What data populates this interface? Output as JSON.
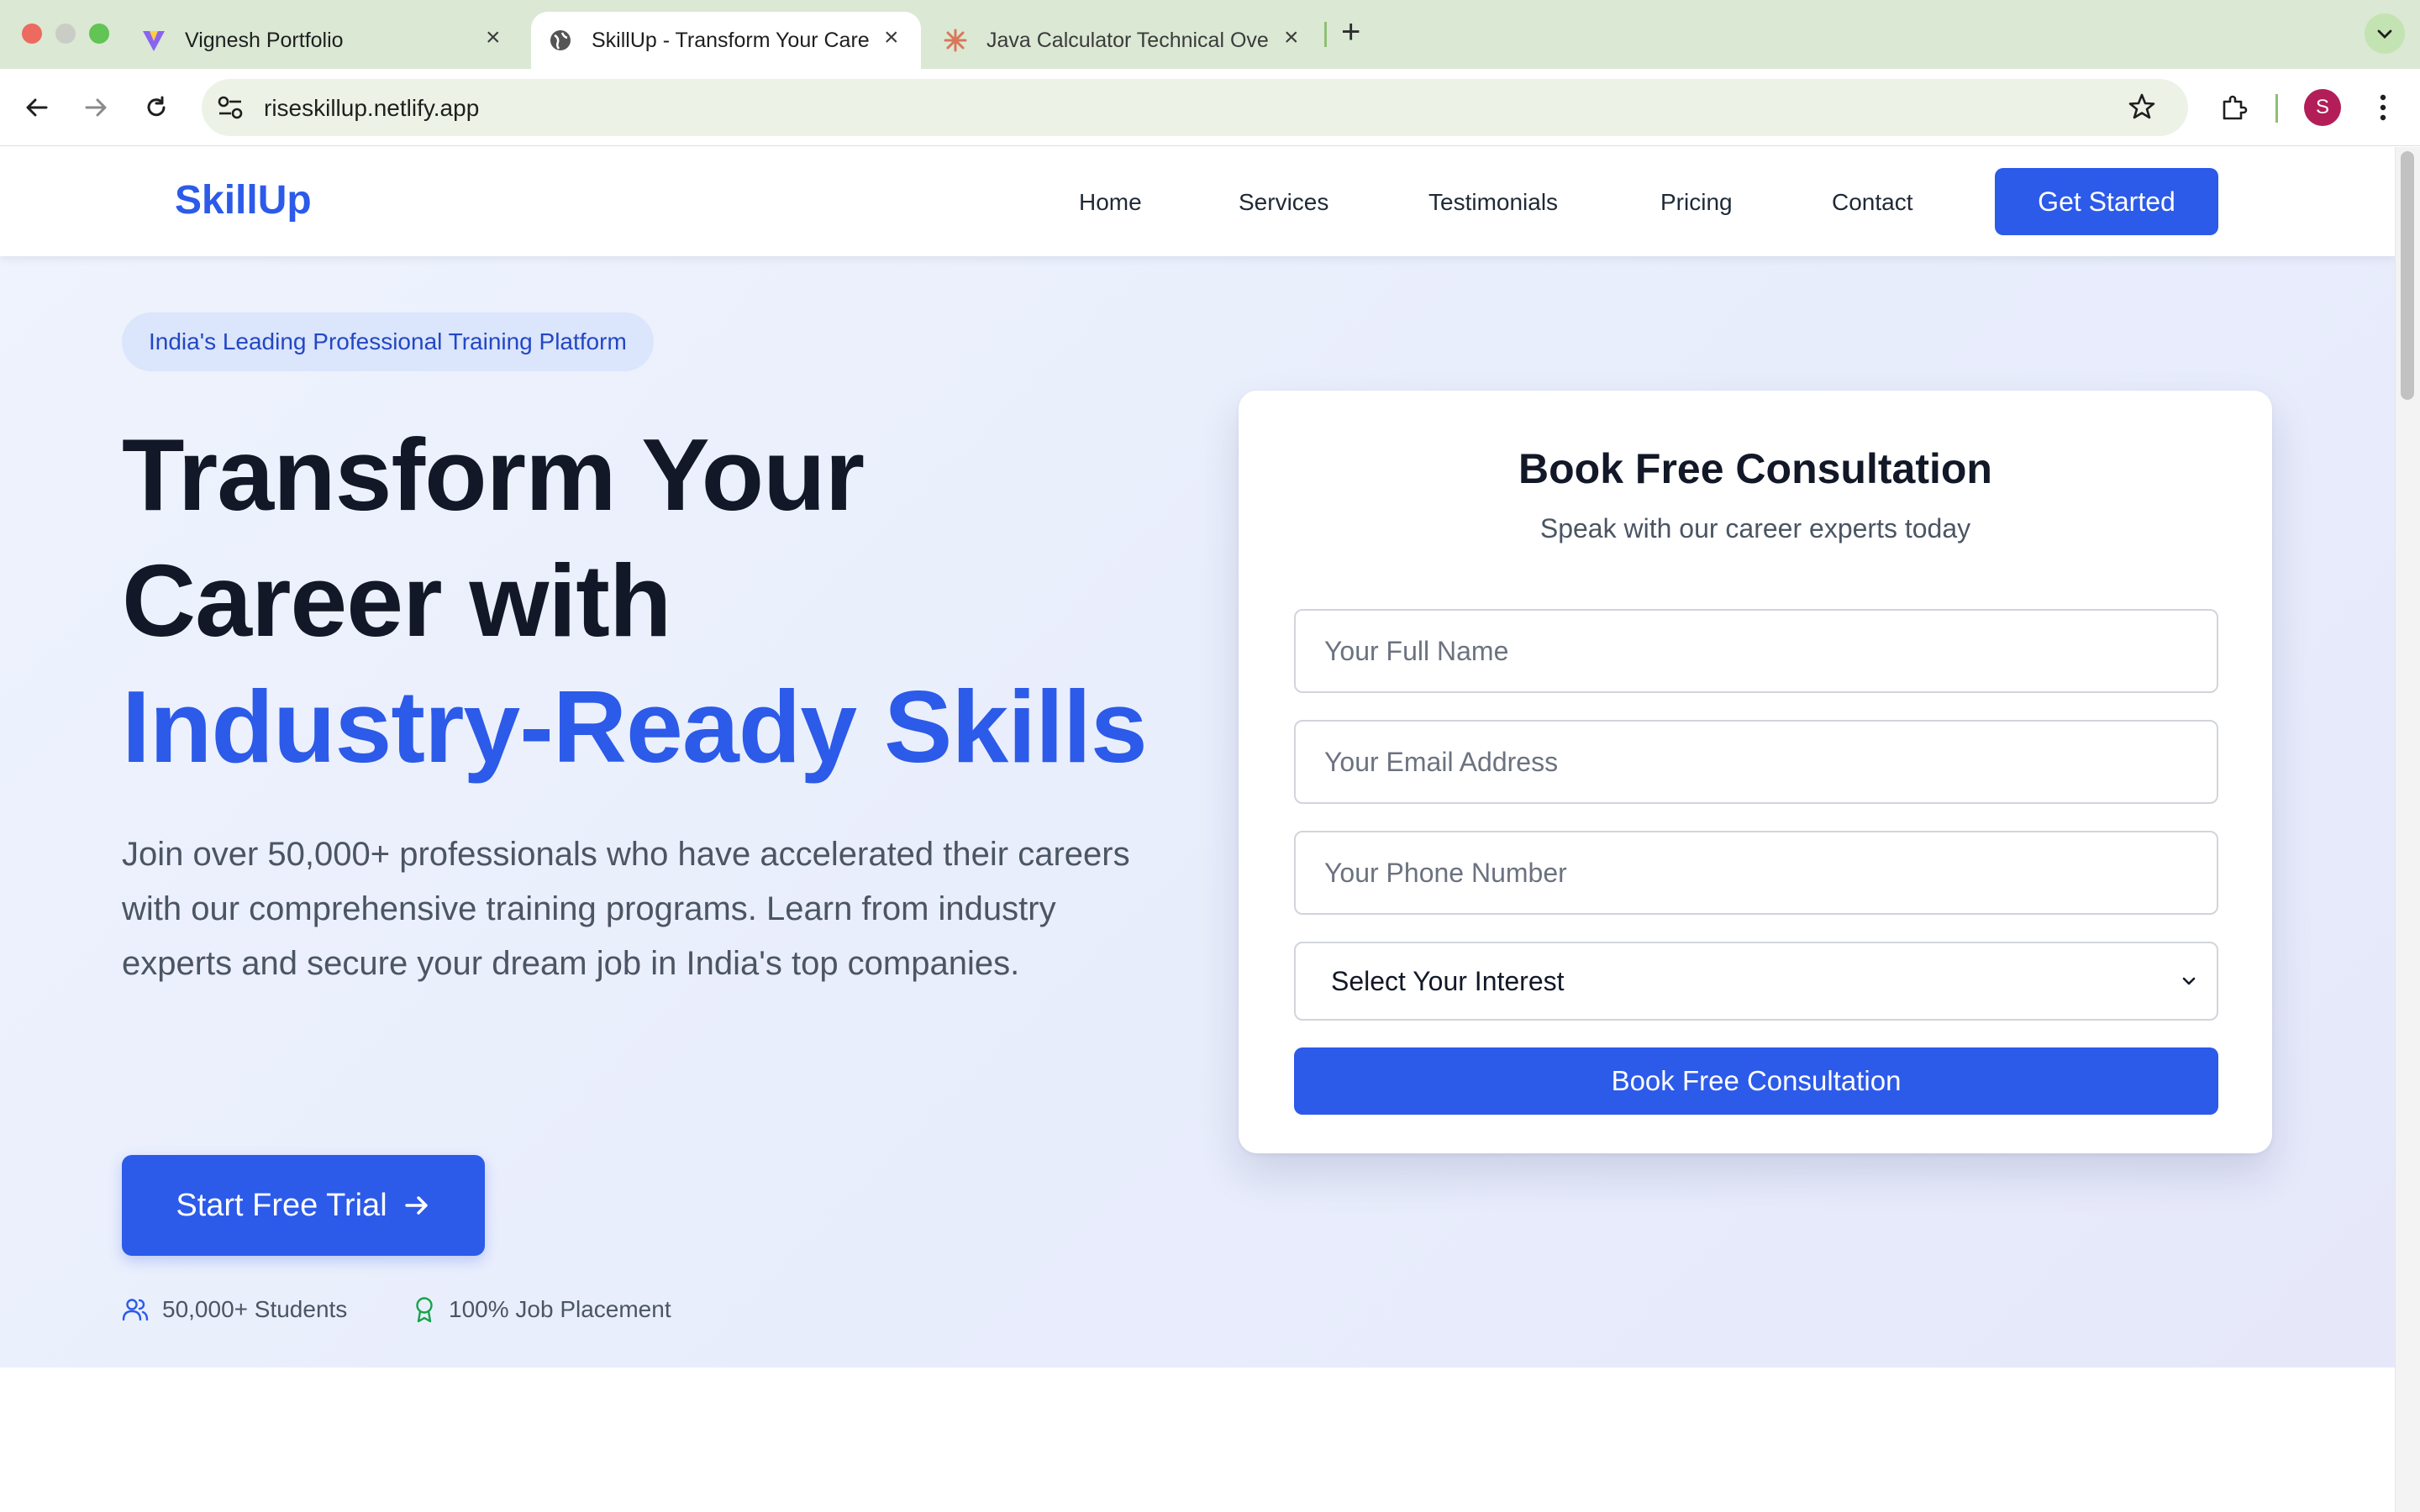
{
  "browser": {
    "tabs": [
      {
        "title": "Vignesh Portfolio",
        "icon": "vite-logo-icon",
        "active": false
      },
      {
        "title": "SkillUp - Transform Your Care",
        "icon": "globe-icon",
        "active": true
      },
      {
        "title": "Java Calculator Technical Ove",
        "icon": "claude-burst-icon",
        "active": false
      }
    ],
    "url": "riseskillup.netlify.app",
    "profile_initial": "S"
  },
  "nav": {
    "logo": "SkillUp",
    "links": [
      "Home",
      "Services",
      "Testimonials",
      "Pricing",
      "Contact"
    ],
    "cta": "Get Started"
  },
  "hero": {
    "badge": "India's Leading Professional Training Platform",
    "headline_line1": "Transform Your",
    "headline_line2": "Career with",
    "headline_highlight": "Industry-Ready Skills",
    "description": "Join over 50,000+ professionals who have accelerated their careers with our comprehensive training programs. Learn from industry experts and secure your dream job in India's top companies.",
    "cta": "Start Free Trial",
    "stats": [
      {
        "text": "50,000+ Students",
        "icon": "users-icon"
      },
      {
        "text": "100% Job Placement",
        "icon": "award-icon"
      }
    ]
  },
  "form": {
    "title": "Book Free Consultation",
    "subtitle": "Speak with our career experts today",
    "name_placeholder": "Your Full Name",
    "email_placeholder": "Your Email Address",
    "phone_placeholder": "Your Phone Number",
    "interest_selected": "Select Your Interest",
    "submit": "Book Free Consultation"
  },
  "colors": {
    "accent": "#2c5ae9",
    "tabstrip": "#dbe8d4",
    "hero_bg": "#eaf0fc"
  }
}
